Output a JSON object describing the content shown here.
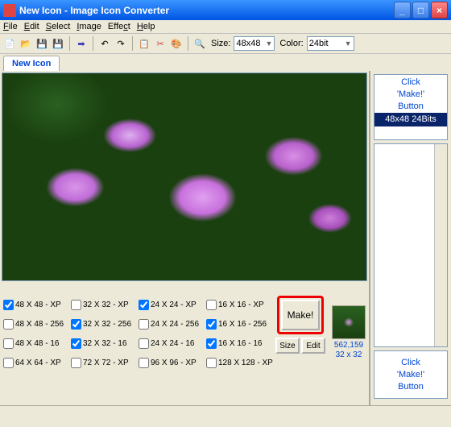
{
  "window": {
    "title": "New Icon - Image Icon Converter"
  },
  "menu": [
    "File",
    "Edit",
    "Select",
    "Image",
    "Effect",
    "Help"
  ],
  "toolbar": {
    "size_label": "Size:",
    "size_value": "48x48",
    "color_label": "Color:",
    "color_value": "24bit"
  },
  "tab": {
    "label": "New Icon"
  },
  "formats": [
    {
      "label": "48 X 48 - XP",
      "checked": true
    },
    {
      "label": "32 X 32 - XP",
      "checked": false
    },
    {
      "label": "24 X 24 - XP",
      "checked": true
    },
    {
      "label": "16 X 16 - XP",
      "checked": false
    },
    {
      "label": "48 X 48 - 256",
      "checked": false
    },
    {
      "label": "32 X 32 - 256",
      "checked": true
    },
    {
      "label": "24 X 24 - 256",
      "checked": false
    },
    {
      "label": "16 X 16 - 256",
      "checked": true
    },
    {
      "label": "48 X 48 - 16",
      "checked": false
    },
    {
      "label": "32 X 32 - 16",
      "checked": true
    },
    {
      "label": "24 X 24 - 16",
      "checked": false
    },
    {
      "label": "16 X 16 - 16",
      "checked": true
    },
    {
      "label": "64 X 64 - XP",
      "checked": false
    },
    {
      "label": "72 X 72 - XP",
      "checked": false
    },
    {
      "label": "96 X 96 - XP",
      "checked": false
    },
    {
      "label": "128 X 128 - XP",
      "checked": false
    }
  ],
  "buttons": {
    "make": "Make!",
    "size": "Size",
    "edit": "Edit"
  },
  "preview": {
    "coords": "562,159",
    "dims": "32 x 32"
  },
  "panel_top": {
    "line1": "Click",
    "line2": "'Make!'",
    "line3": "Button",
    "selected": "48x48 24Bits"
  },
  "panel_bottom": {
    "line1": "Click",
    "line2": "'Make!'",
    "line3": "Button"
  }
}
